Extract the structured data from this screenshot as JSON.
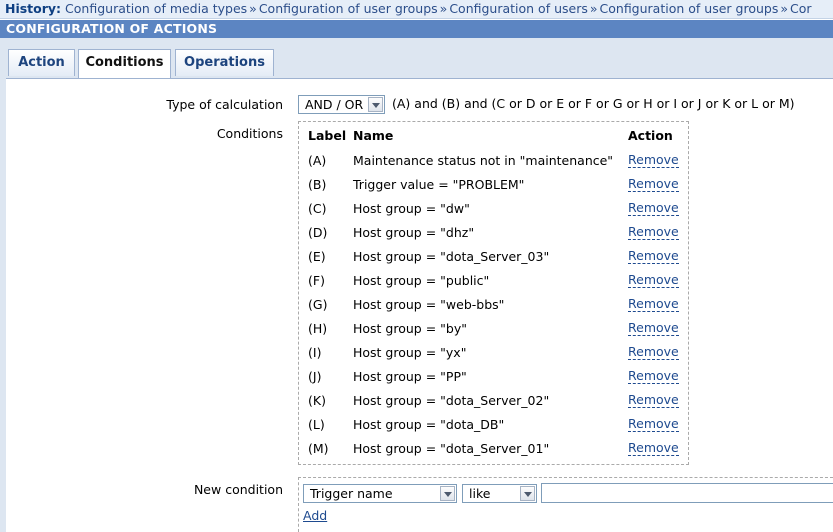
{
  "history": {
    "label": "History:",
    "items": [
      "Configuration of media types",
      "Configuration of user groups",
      "Configuration of users",
      "Configuration of user groups",
      "Cor"
    ],
    "separator": "»"
  },
  "page_title": "CONFIGURATION OF ACTIONS",
  "tabs": [
    {
      "label": "Action",
      "active": false
    },
    {
      "label": "Conditions",
      "active": true
    },
    {
      "label": "Operations",
      "active": false
    }
  ],
  "calculation": {
    "label": "Type of calculation",
    "selected": "AND / OR",
    "formula": "(A) and (B) and (C or D or E or F or G or H or I or J or K or L or M)"
  },
  "conditions": {
    "label": "Conditions",
    "headers": {
      "label": "Label",
      "name": "Name",
      "action": "Action"
    },
    "rows": [
      {
        "label": "(A)",
        "name": "Maintenance status not in \"maintenance\"",
        "action": "Remove"
      },
      {
        "label": "(B)",
        "name": "Trigger value = \"PROBLEM\"",
        "action": "Remove"
      },
      {
        "label": "(C)",
        "name": "Host group = \"dw\"",
        "action": "Remove"
      },
      {
        "label": "(D)",
        "name": "Host group = \"dhz\"",
        "action": "Remove"
      },
      {
        "label": "(E)",
        "name": "Host group = \"dota_Server_03\"",
        "action": "Remove"
      },
      {
        "label": "(F)",
        "name": "Host group = \"public\"",
        "action": "Remove"
      },
      {
        "label": "(G)",
        "name": "Host group = \"web-bbs\"",
        "action": "Remove"
      },
      {
        "label": "(H)",
        "name": "Host group = \"by\"",
        "action": "Remove"
      },
      {
        "label": "(I)",
        "name": "Host group = \"yx\"",
        "action": "Remove"
      },
      {
        "label": "(J)",
        "name": "Host group = \"PP\"",
        "action": "Remove"
      },
      {
        "label": "(K)",
        "name": "Host group = \"dota_Server_02\"",
        "action": "Remove"
      },
      {
        "label": "(L)",
        "name": "Host group = \"dota_DB\"",
        "action": "Remove"
      },
      {
        "label": "(M)",
        "name": "Host group = \"dota_Server_01\"",
        "action": "Remove"
      }
    ]
  },
  "new_condition": {
    "label": "New condition",
    "type_selected": "Trigger name",
    "operator_selected": "like",
    "value": "",
    "add_label": "Add"
  }
}
